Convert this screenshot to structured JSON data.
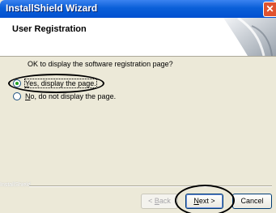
{
  "window": {
    "title": "InstallShield Wizard",
    "close_glyph": "✕"
  },
  "header": {
    "title": "User Registration"
  },
  "dialog": {
    "question": "OK to display the software registration page?",
    "options": [
      {
        "mnemonic": "Y",
        "rest": "es, display the page.",
        "selected": true
      },
      {
        "mnemonic": "N",
        "rest": "o, do not display the page.",
        "selected": false
      }
    ]
  },
  "footer": {
    "brand": "InstallShield",
    "back_pre": "< ",
    "back_mn": "B",
    "back_post": "ack",
    "next_mn": "N",
    "next_post": "ext >",
    "cancel_label": "Cancel"
  },
  "colors": {
    "titlebar": "#0a5fd8",
    "dialog_bg": "#ece9d8",
    "radio_dot": "#21a121"
  }
}
